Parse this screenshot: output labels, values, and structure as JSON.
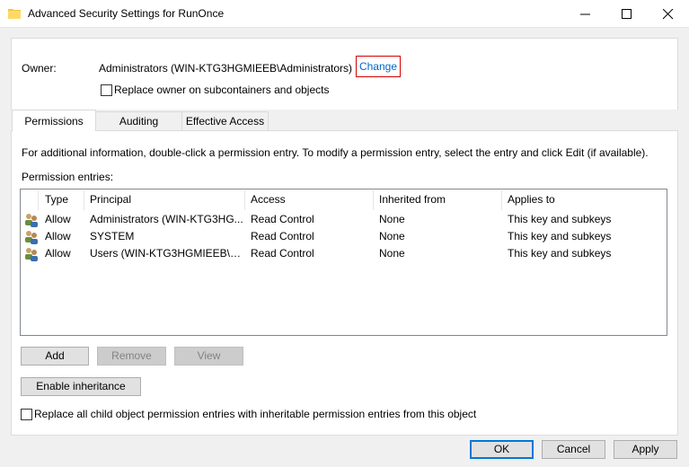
{
  "window": {
    "title": "Advanced Security Settings for RunOnce",
    "icon": "folder-icon"
  },
  "owner": {
    "label": "Owner:",
    "value": "Administrators (WIN-KTG3HGMIEEB\\Administrators)",
    "change_link": "Change",
    "replace_owner_label": "Replace owner on subcontainers and objects",
    "replace_owner_checked": false
  },
  "tabs": [
    {
      "label": "Permissions",
      "active": true
    },
    {
      "label": "Auditing",
      "active": false
    },
    {
      "label": "Effective Access",
      "active": false
    }
  ],
  "permissions": {
    "info_text": "For additional information, double-click a permission entry. To modify a permission entry, select the entry and click Edit (if available).",
    "entries_label": "Permission entries:",
    "columns": [
      "Type",
      "Principal",
      "Access",
      "Inherited from",
      "Applies to"
    ],
    "rows": [
      {
        "type": "Allow",
        "principal": "Administrators (WIN-KTG3HG...",
        "access": "Read Control",
        "inherited": "None",
        "applies": "This key and subkeys"
      },
      {
        "type": "Allow",
        "principal": "SYSTEM",
        "access": "Read Control",
        "inherited": "None",
        "applies": "This key and subkeys"
      },
      {
        "type": "Allow",
        "principal": "Users (WIN-KTG3HGMIEEB\\Us...",
        "access": "Read Control",
        "inherited": "None",
        "applies": "This key and subkeys"
      }
    ],
    "buttons": {
      "add": "Add",
      "remove": "Remove",
      "view": "View"
    },
    "enable_inheritance": "Enable inheritance",
    "replace_child_label": "Replace all child object permission entries with inheritable permission entries from this object",
    "replace_child_checked": false
  },
  "footer": {
    "ok": "OK",
    "cancel": "Cancel",
    "apply": "Apply"
  },
  "colors": {
    "link": "#0066cc",
    "focus": "#0078d7",
    "highlight_border": "#d00000"
  }
}
